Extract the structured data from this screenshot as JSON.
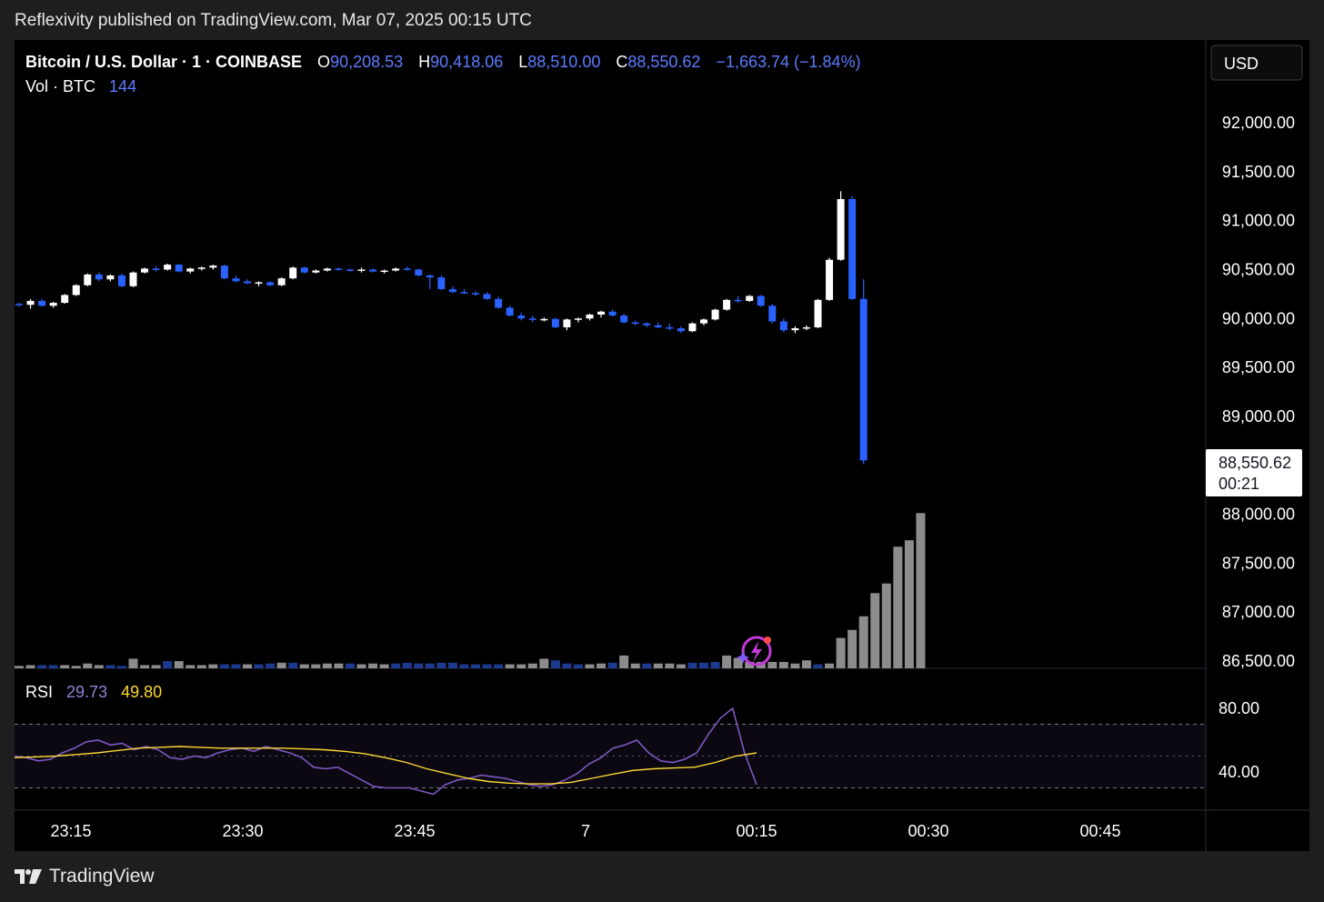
{
  "header": {
    "published_text": "Reflexivity published on TradingView.com, Mar 07, 2025 00:15 UTC"
  },
  "legend": {
    "symbol": "Bitcoin / U.S. Dollar · 1 · COINBASE",
    "o_label": "O",
    "o_value": "90,208.53",
    "h_label": "H",
    "h_value": "90,418.06",
    "l_label": "L",
    "l_value": "88,510.00",
    "c_label": "C",
    "c_value": "88,550.62",
    "change": "−1,663.74 (−1.84%)",
    "vol_label": "Vol · BTC",
    "vol_value": "144"
  },
  "currency_button": "USD",
  "last_price": {
    "price": "88,550.62",
    "countdown": "00:21"
  },
  "rsi": {
    "label": "RSI",
    "value": "29.73",
    "ma_value": "49.80"
  },
  "brand": {
    "name": "TradingView"
  },
  "colors": {
    "up": "#ffffff",
    "down": "#2962ff",
    "vol_up": "#8c8c8c",
    "vol_down": "#1c3a8f",
    "rsi_line": "#7e57c2",
    "rsi_ma": "#fdd835",
    "accent": "#5b7cff",
    "background": "#000000"
  },
  "icons": {
    "brand_logo": "tradingview-logo-icon",
    "alert": "lightning-alert-icon"
  },
  "chart_data": [
    {
      "type": "candlestick",
      "ylim": [
        86500,
        92000
      ],
      "price_ticks": [
        "92,000.00",
        "91,500.00",
        "91,000.00",
        "90,500.00",
        "90,000.00",
        "89,500.00",
        "89,000.00",
        "88,000.00",
        "87,500.00",
        "87,000.00",
        "86,500.00"
      ],
      "time_ticks": [
        "23:15",
        "23:30",
        "23:45",
        "7",
        "00:15",
        "00:30",
        "00:45"
      ],
      "candles": [
        [
          90150,
          90160,
          90120,
          90140
        ],
        [
          90140,
          90200,
          90100,
          90180
        ],
        [
          90180,
          90200,
          90120,
          90130
        ],
        [
          90130,
          90170,
          90110,
          90160
        ],
        [
          90160,
          90250,
          90150,
          90240
        ],
        [
          90240,
          90350,
          90230,
          90340
        ],
        [
          90340,
          90460,
          90330,
          90450
        ],
        [
          90450,
          90470,
          90380,
          90400
        ],
        [
          90400,
          90450,
          90380,
          90440
        ],
        [
          90440,
          90460,
          90320,
          90330
        ],
        [
          90330,
          90480,
          90320,
          90470
        ],
        [
          90470,
          90520,
          90460,
          90510
        ],
        [
          90510,
          90530,
          90480,
          90500
        ],
        [
          90500,
          90560,
          90490,
          90550
        ],
        [
          90550,
          90560,
          90470,
          90480
        ],
        [
          90480,
          90520,
          90460,
          90510
        ],
        [
          90510,
          90530,
          90490,
          90520
        ],
        [
          90520,
          90550,
          90500,
          90540
        ],
        [
          90540,
          90550,
          90400,
          90410
        ],
        [
          90410,
          90440,
          90370,
          90380
        ],
        [
          90380,
          90400,
          90350,
          90360
        ],
        [
          90360,
          90380,
          90330,
          90370
        ],
        [
          90370,
          90380,
          90330,
          90340
        ],
        [
          90340,
          90420,
          90330,
          90410
        ],
        [
          90410,
          90530,
          90400,
          90520
        ],
        [
          90520,
          90530,
          90460,
          90470
        ],
        [
          90470,
          90500,
          90460,
          90490
        ],
        [
          90490,
          90520,
          90480,
          90510
        ],
        [
          90510,
          90520,
          90490,
          90500
        ],
        [
          90500,
          90510,
          90480,
          90490
        ],
        [
          90490,
          90520,
          90470,
          90500
        ],
        [
          90500,
          90510,
          90470,
          90480
        ],
        [
          90480,
          90500,
          90460,
          90490
        ],
        [
          90490,
          90520,
          90480,
          90510
        ],
        [
          90510,
          90530,
          90490,
          90500
        ],
        [
          90500,
          90510,
          90430,
          90440
        ],
        [
          90440,
          90450,
          90300,
          90420
        ],
        [
          90420,
          90440,
          90290,
          90300
        ],
        [
          90300,
          90330,
          90260,
          90270
        ],
        [
          90270,
          90300,
          90250,
          90260
        ],
        [
          90260,
          90280,
          90230,
          90250
        ],
        [
          90250,
          90270,
          90190,
          90200
        ],
        [
          90200,
          90220,
          90100,
          90110
        ],
        [
          90110,
          90130,
          90020,
          90030
        ],
        [
          90030,
          90060,
          89980,
          90000
        ],
        [
          90000,
          90030,
          89960,
          89990
        ],
        [
          89990,
          90010,
          89970,
          89995
        ],
        [
          89995,
          90010,
          89900,
          89910
        ],
        [
          89910,
          90000,
          89880,
          89990
        ],
        [
          89990,
          90010,
          89960,
          90000
        ],
        [
          90000,
          90050,
          89980,
          90040
        ],
        [
          90040,
          90080,
          90010,
          90070
        ],
        [
          90070,
          90090,
          90020,
          90030
        ],
        [
          90030,
          90050,
          89950,
          89960
        ],
        [
          89960,
          89980,
          89930,
          89950
        ],
        [
          89950,
          89960,
          89910,
          89930
        ],
        [
          89930,
          89960,
          89900,
          89910
        ],
        [
          89910,
          89950,
          89880,
          89900
        ],
        [
          89900,
          89920,
          89850,
          89870
        ],
        [
          89870,
          89960,
          89860,
          89950
        ],
        [
          89950,
          90000,
          89930,
          89990
        ],
        [
          89990,
          90100,
          89980,
          90090
        ],
        [
          90090,
          90200,
          90080,
          90190
        ],
        [
          90190,
          90230,
          90160,
          90180
        ],
        [
          90180,
          90240,
          90170,
          90230
        ],
        [
          90230,
          90240,
          90120,
          90130
        ],
        [
          90130,
          90150,
          89950,
          89970
        ],
        [
          89970,
          90000,
          89860,
          89880
        ],
        [
          89880,
          89920,
          89850,
          89900
        ],
        [
          89900,
          89930,
          89880,
          89910
        ],
        [
          89910,
          90200,
          89900,
          90190
        ],
        [
          90190,
          90620,
          90180,
          90600
        ],
        [
          90600,
          91300,
          90590,
          91220
        ],
        [
          91220,
          91250,
          90190,
          90200
        ],
        [
          90200,
          90400,
          88510,
          88550
        ]
      ],
      "volumes": [
        3,
        4,
        4,
        4,
        4,
        3,
        6,
        4,
        4,
        3,
        12,
        4,
        4,
        9,
        9,
        4,
        4,
        5,
        5,
        5,
        5,
        5,
        6,
        7,
        7,
        5,
        5,
        6,
        6,
        6,
        5,
        6,
        5,
        6,
        7,
        6,
        6,
        7,
        7,
        5,
        5,
        5,
        5,
        5,
        5,
        6,
        12,
        10,
        6,
        5,
        5,
        6,
        7,
        16,
        6,
        6,
        6,
        6,
        5,
        7,
        7,
        8,
        16,
        13,
        8,
        8,
        8,
        8,
        6,
        10,
        5,
        6,
        38,
        48,
        65,
        94,
        106,
        152,
        160,
        194
      ],
      "volume_directions": "uudduuuudduuuduuuuddudduduuuuduuudddddddddduuuuddduuduuduuuddduuuuuuuud"
    },
    {
      "type": "line",
      "title": "RSI",
      "ylim": [
        20,
        100
      ],
      "y_ticks": [
        "80.00",
        "40.00"
      ],
      "bands": [
        30,
        50,
        70
      ],
      "series": [
        {
          "name": "RSI",
          "values": [
            50,
            49,
            47,
            48,
            52,
            55,
            59,
            60,
            57,
            58,
            54,
            56,
            54,
            49,
            48,
            50,
            49,
            52,
            54,
            55,
            53,
            56,
            54,
            52,
            49,
            43,
            42,
            43,
            39,
            35,
            31,
            30,
            30,
            30,
            28,
            26,
            32,
            35,
            36,
            38,
            37,
            36,
            34,
            32,
            31,
            32,
            35,
            39,
            45,
            49,
            55,
            57,
            60,
            52,
            47,
            46,
            48,
            52,
            64,
            74,
            80,
            52,
            32
          ]
        },
        {
          "name": "RSI MA",
          "values": [
            49,
            49.5,
            50,
            51,
            52,
            53.5,
            55,
            55.5,
            56,
            55.5,
            55,
            55,
            55,
            55,
            54.5,
            54,
            53,
            51.5,
            49,
            46,
            42,
            39,
            36,
            34,
            33,
            32.5,
            32.5,
            33.5,
            36,
            38.5,
            41,
            42,
            42.5,
            43,
            46,
            50,
            52
          ]
        }
      ]
    }
  ]
}
